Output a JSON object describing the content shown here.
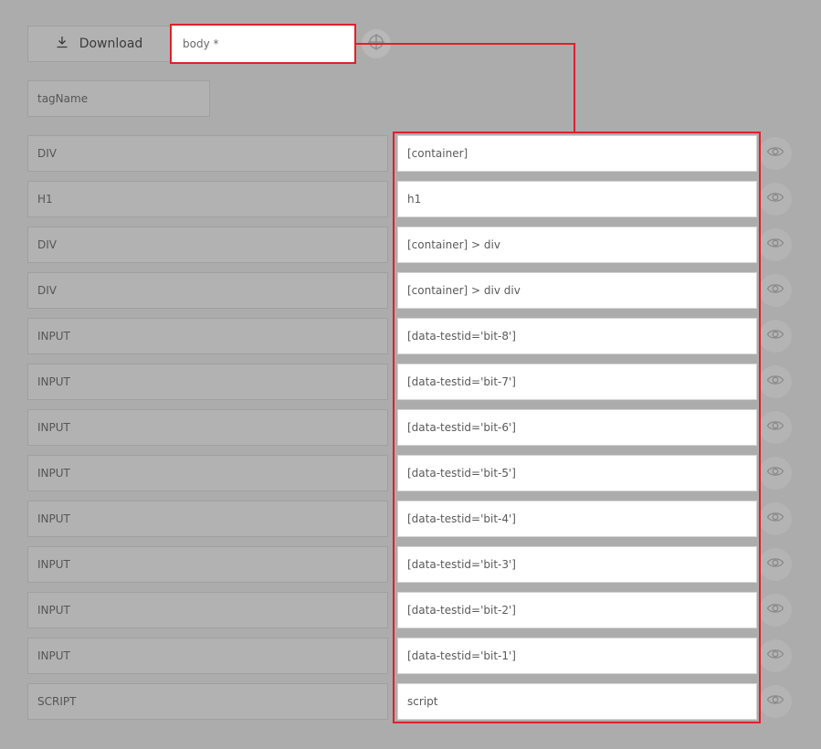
{
  "toolbar": {
    "download_label": "Download",
    "root_selector_value": "body *"
  },
  "filter": {
    "tag_name_placeholder": "tagName"
  },
  "rows": [
    {
      "tag": "DIV",
      "selector": "[container]"
    },
    {
      "tag": "H1",
      "selector": "h1"
    },
    {
      "tag": "DIV",
      "selector": "[container] > div"
    },
    {
      "tag": "DIV",
      "selector": "[container] > div div"
    },
    {
      "tag": "INPUT",
      "selector": "[data-testid='bit-8']"
    },
    {
      "tag": "INPUT",
      "selector": "[data-testid='bit-7']"
    },
    {
      "tag": "INPUT",
      "selector": "[data-testid='bit-6']"
    },
    {
      "tag": "INPUT",
      "selector": "[data-testid='bit-5']"
    },
    {
      "tag": "INPUT",
      "selector": "[data-testid='bit-4']"
    },
    {
      "tag": "INPUT",
      "selector": "[data-testid='bit-3']"
    },
    {
      "tag": "INPUT",
      "selector": "[data-testid='bit-2']"
    },
    {
      "tag": "INPUT",
      "selector": "[data-testid='bit-1']"
    },
    {
      "tag": "SCRIPT",
      "selector": "script"
    }
  ],
  "colors": {
    "highlight": "#e0202a",
    "overlay_background": "#acacac"
  },
  "icons": {
    "download": "download-icon",
    "target": "crosshair-icon",
    "row_action": "eye-icon"
  }
}
